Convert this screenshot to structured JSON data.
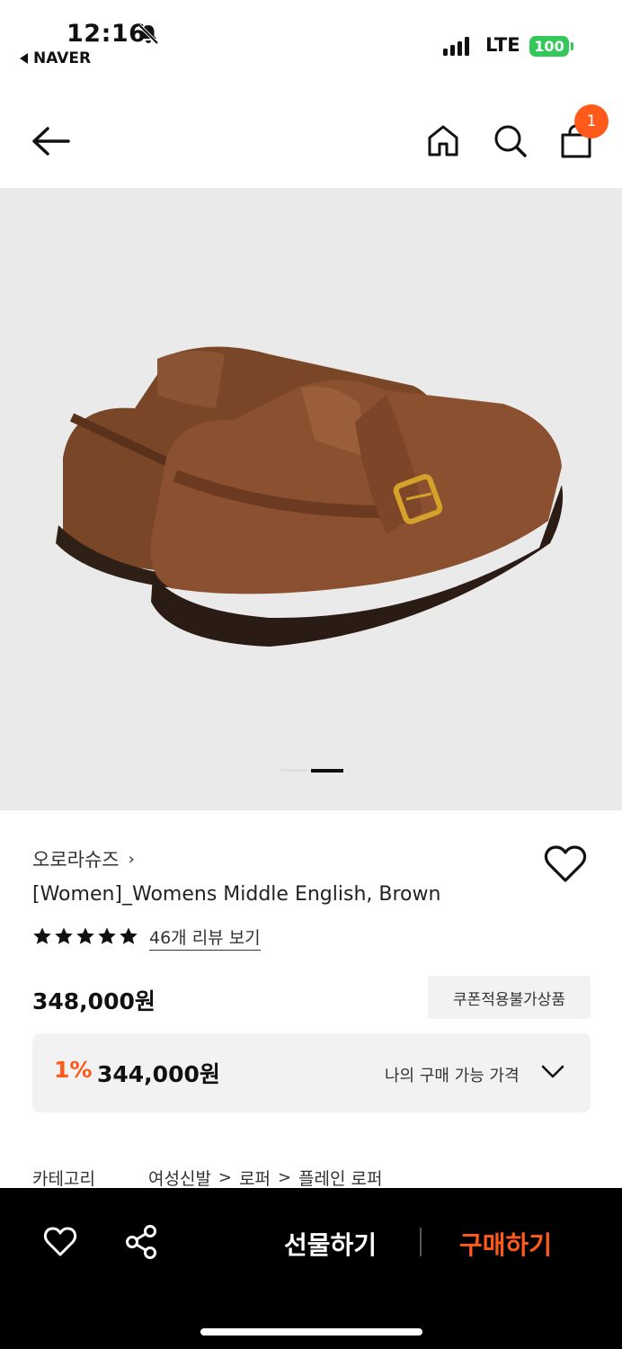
{
  "status_bar": {
    "time": "12:16",
    "back_app": "NAVER",
    "network": "LTE",
    "battery": "100"
  },
  "header": {
    "cart_count": "1"
  },
  "carousel": {
    "current_index": 2,
    "total": 2
  },
  "product": {
    "brand": "오로라슈즈",
    "brand_chevron": "›",
    "name": "[Women]_Womens Middle English, Brown",
    "rating_stars": 5,
    "review_link": "46개 리뷰 보기",
    "price": "348,000원",
    "coupon_notice": "쿠폰적용불가상품",
    "my_price": {
      "discount": "1%",
      "price": "344,000원",
      "label": "나의 구매 가능 가격"
    },
    "category": {
      "label": "카테고리",
      "path": [
        "여성신발",
        "로퍼",
        "플레인 로퍼"
      ],
      "separator": ">"
    }
  },
  "bottom_bar": {
    "gift_label": "선물하기",
    "buy_label": "구매하기"
  },
  "colors": {
    "accent": "#ff5a1a",
    "battery": "#34c759",
    "hero_bg": "#ebeaeb",
    "bottom_bar": "#000000"
  },
  "icons": [
    "bell-slash-icon",
    "back-arrow-icon",
    "home-icon",
    "search-icon",
    "cart-icon",
    "heart-icon",
    "star-icon",
    "chevron-down-icon",
    "share-icon"
  ]
}
